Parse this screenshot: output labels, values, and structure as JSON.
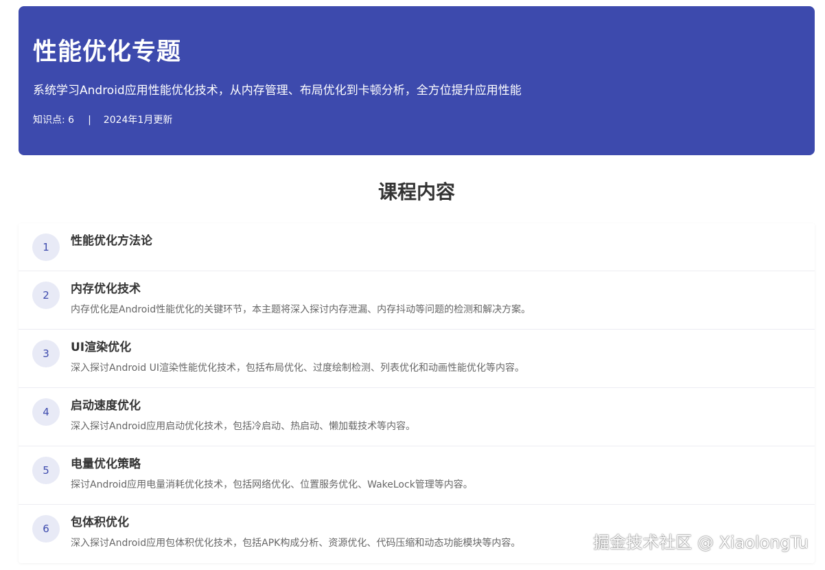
{
  "hero": {
    "title": "性能优化专题",
    "description": "系统学习Android应用性能优化技术，从内存管理、布局优化到卡顿分析，全方位提升应用性能",
    "meta_points": "知识点: 6",
    "meta_separator": "|",
    "meta_updated": "2024年1月更新"
  },
  "section": {
    "title": "课程内容"
  },
  "items": [
    {
      "number": "1",
      "title": "性能优化方法论",
      "description": ""
    },
    {
      "number": "2",
      "title": "内存优化技术",
      "description": "内存优化是Android性能优化的关键环节，本主题将深入探讨内存泄漏、内存抖动等问题的检测和解决方案。"
    },
    {
      "number": "3",
      "title": "UI渲染优化",
      "description": "深入探讨Android UI渲染性能优化技术，包括布局优化、过度绘制检测、列表优化和动画性能优化等内容。"
    },
    {
      "number": "4",
      "title": "启动速度优化",
      "description": "深入探讨Android应用启动优化技术，包括冷启动、热启动、懒加载技术等内容。"
    },
    {
      "number": "5",
      "title": "电量优化策略",
      "description": "探讨Android应用电量消耗优化技术，包括网络优化、位置服务优化、WakeLock管理等内容。"
    },
    {
      "number": "6",
      "title": "包体积优化",
      "description": "深入探讨Android应用包体积优化技术，包括APK构成分析、资源优化、代码压缩和动态功能模块等内容。"
    }
  ],
  "watermark": "掘金技术社区 @ XiaolongTu",
  "colors": {
    "hero_background": "#3d4aad",
    "number_badge_background": "#e8eaf6",
    "number_badge_text": "#3d4aad"
  }
}
